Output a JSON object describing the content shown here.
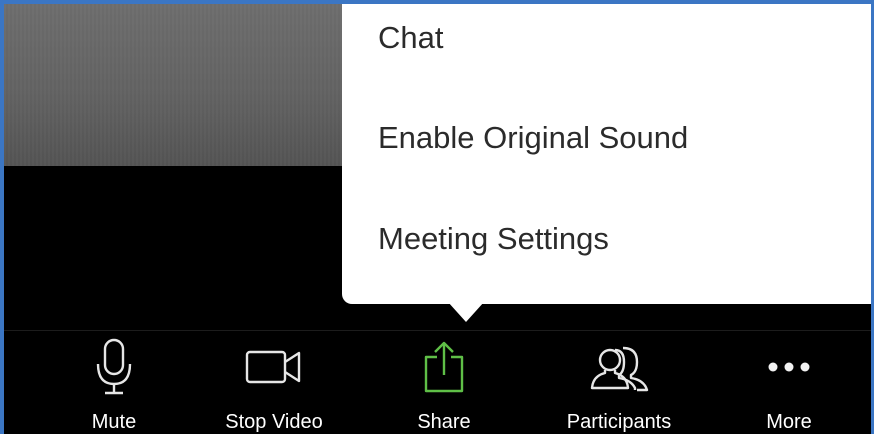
{
  "menu": {
    "items": [
      {
        "label": "Chat"
      },
      {
        "label": "Enable Original Sound"
      },
      {
        "label": "Meeting Settings"
      }
    ]
  },
  "toolbar": {
    "items": [
      {
        "label": "Mute",
        "icon": "microphone-icon"
      },
      {
        "label": "Stop Video",
        "icon": "video-camera-icon"
      },
      {
        "label": "Share",
        "icon": "share-icon"
      },
      {
        "label": "Participants",
        "icon": "participants-icon"
      },
      {
        "label": "More",
        "icon": "more-dots-icon"
      }
    ]
  },
  "colors": {
    "frame_border": "#3b76c4",
    "share_accent": "#5fbf47",
    "menu_background": "#ffffff",
    "toolbar_background": "#000000"
  }
}
